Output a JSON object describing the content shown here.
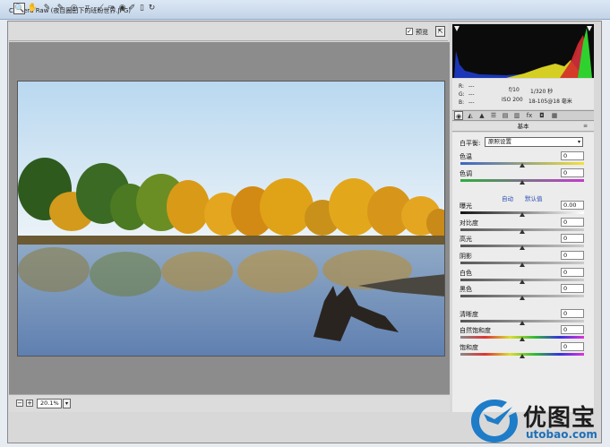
{
  "window": {
    "title": "Camera Raw (夜目圈田下的班盼世界.JPG)"
  },
  "toolbar": {
    "tools": [
      {
        "name": "zoom-tool",
        "glyph": "🔍"
      },
      {
        "name": "hand-tool",
        "glyph": "✋"
      },
      {
        "name": "white-balance-tool",
        "glyph": "✎"
      },
      {
        "name": "color-sampler-tool",
        "glyph": "✎"
      },
      {
        "name": "targeted-adjustment-tool",
        "glyph": "◎"
      },
      {
        "name": "crop-tool",
        "glyph": "⌗"
      },
      {
        "name": "straighten-tool",
        "glyph": "⟋"
      },
      {
        "name": "spot-removal-tool",
        "glyph": "✑"
      },
      {
        "name": "red-eye-tool",
        "glyph": "◉"
      },
      {
        "name": "adjustment-brush-tool",
        "glyph": "✐"
      },
      {
        "name": "graduated-filter-tool",
        "glyph": "▯"
      },
      {
        "name": "rotate-tool",
        "glyph": "↻"
      }
    ],
    "preview_label": "预览",
    "preview_checked": "✓",
    "fullscreen_glyph": "⇱"
  },
  "bottom": {
    "zoom_out": "−",
    "zoom_in": "+",
    "zoom_value": "20.1%",
    "zoom_arrow": "▾"
  },
  "info": {
    "r_label": "R:",
    "g_label": "G:",
    "b_label": "B:",
    "r_value": "---",
    "g_value": "---",
    "b_value": "---",
    "aperture": "f/10",
    "shutter": "1/320 秒",
    "iso": "ISO 200",
    "focal": "18-105@18 毫米"
  },
  "panel": {
    "tabs": [
      "◉",
      "◭",
      "▲",
      "☰",
      "▤",
      "▥",
      "fx",
      "◘",
      "▦"
    ],
    "section_title": "基本",
    "menu_icon": "≡",
    "wb_label": "白平衡:",
    "wb_value": "原照设置",
    "wb_arrow": "▾",
    "auto_label": "自动",
    "default_label": "默认值",
    "sliders": [
      {
        "label": "色温",
        "value": "0",
        "position": 0.5
      },
      {
        "label": "色调",
        "value": "0",
        "position": 0.5
      },
      {
        "label": "曝光",
        "value": "0.00",
        "position": 0.5
      },
      {
        "label": "对比度",
        "value": "0",
        "position": 0.5
      },
      {
        "label": "高光",
        "value": "0",
        "position": 0.5
      },
      {
        "label": "阴影",
        "value": "0",
        "position": 0.5
      },
      {
        "label": "白色",
        "value": "0",
        "position": 0.5
      },
      {
        "label": "黑色",
        "value": "0",
        "position": 0.5
      },
      {
        "label": "清晰度",
        "value": "0",
        "position": 0.5
      },
      {
        "label": "自然饱和度",
        "value": "0",
        "position": 0.5
      },
      {
        "label": "饱和度",
        "value": "0",
        "position": 0.5
      }
    ]
  },
  "watermark": {
    "text": "优图宝",
    "url": "utobao.com"
  },
  "colors": {
    "accent": "#2a4fb0",
    "panel": "#ececec",
    "canvas": "#8c8c8c"
  }
}
